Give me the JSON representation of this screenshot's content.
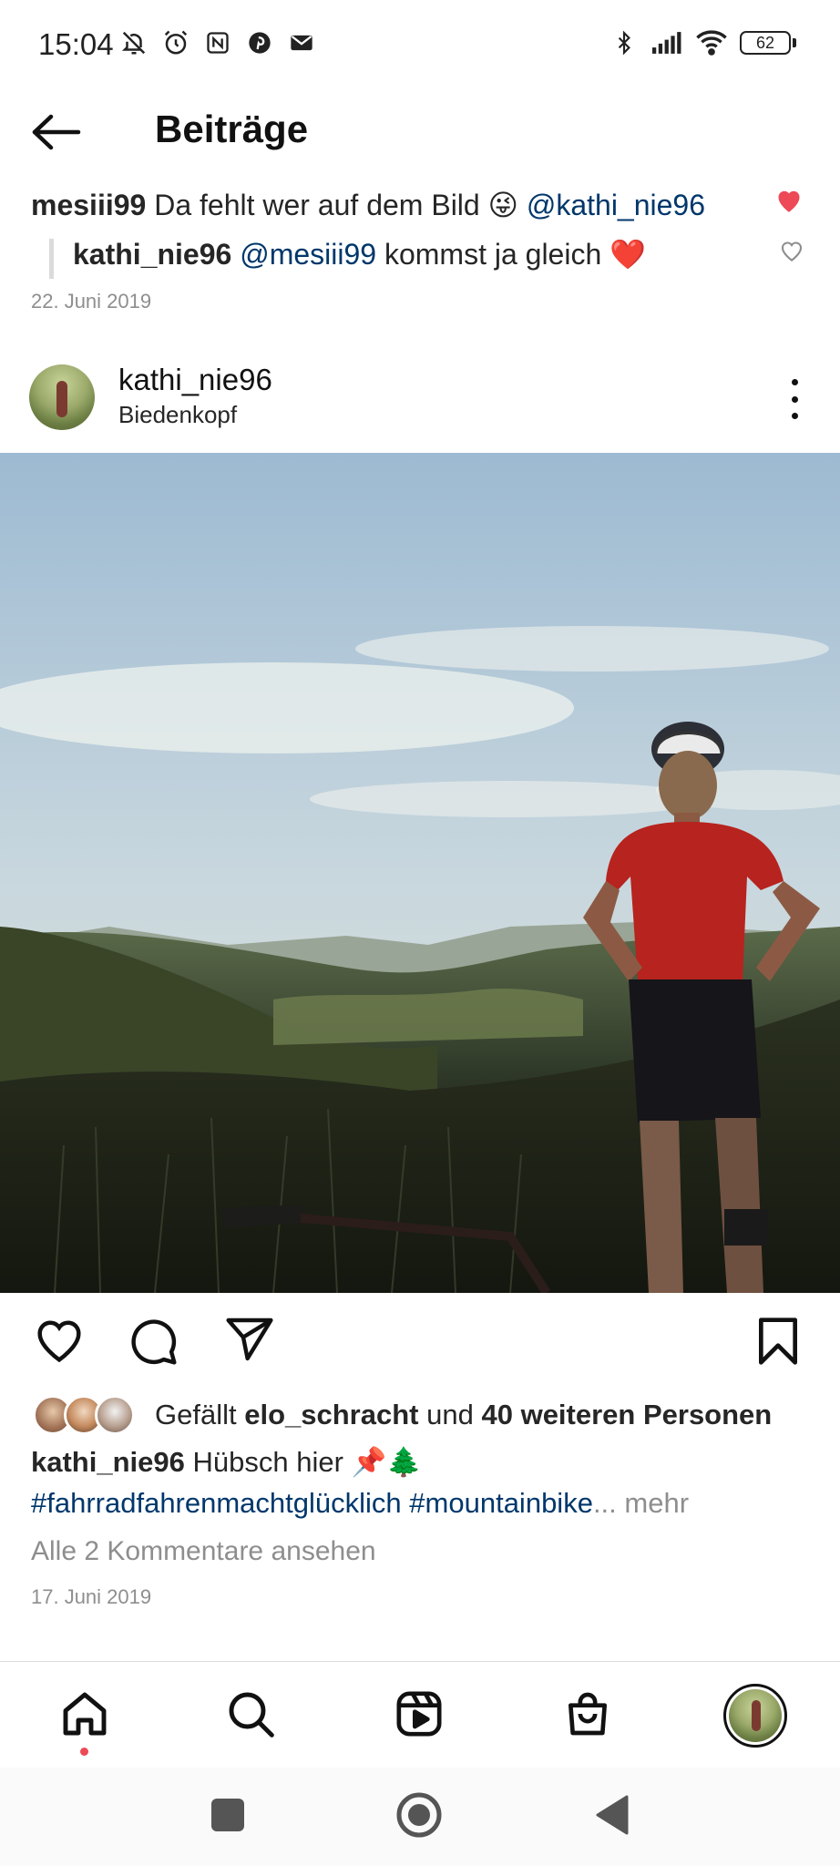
{
  "status_bar": {
    "time": "15:04",
    "battery": "62",
    "left_icons": [
      "bell-off-icon",
      "alarm-icon",
      "nfc-icon",
      "pinterest-icon",
      "mail-icon"
    ],
    "right_icons": [
      "bluetooth-icon",
      "signal-icon",
      "wifi-icon",
      "battery-icon"
    ]
  },
  "header": {
    "title": "Beiträge",
    "back_icon": "arrow-left-icon"
  },
  "comment": {
    "username": "mesiii99",
    "text": "Da fehlt wer auf dem Bild 😜",
    "mention": "@kathi_nie96",
    "liked": true,
    "reply": {
      "username": "kathi_nie96",
      "mention": "@mesiii99",
      "text": "kommst ja gleich ❤️",
      "liked": false
    },
    "date": "22. Juni 2019"
  },
  "post": {
    "username": "kathi_nie96",
    "location": "Biedenkopf",
    "likes": {
      "prefix": "Gefällt",
      "liker": "elo_schracht",
      "middle": "und",
      "others": "40 weiteren Personen"
    },
    "caption": {
      "username": "kathi_nie96",
      "text": "Hübsch hier 📌🌲",
      "hashtag1": "#fahrradfahrenmachtglücklich",
      "hashtag2": "#mountainbike",
      "ellipsis": "...",
      "more": "mehr"
    },
    "view_comments": "Alle 2 Kommentare ansehen",
    "date": "17. Juni 2019"
  },
  "colors": {
    "like_red": "#ed4956",
    "mention_blue": "#00376b",
    "muted_gray": "#8e8e8e"
  },
  "bottom_nav": [
    "home-icon",
    "search-icon",
    "reels-icon",
    "shop-icon",
    "profile-avatar"
  ],
  "system_nav": [
    "recents-button",
    "home-button",
    "back-button"
  ]
}
